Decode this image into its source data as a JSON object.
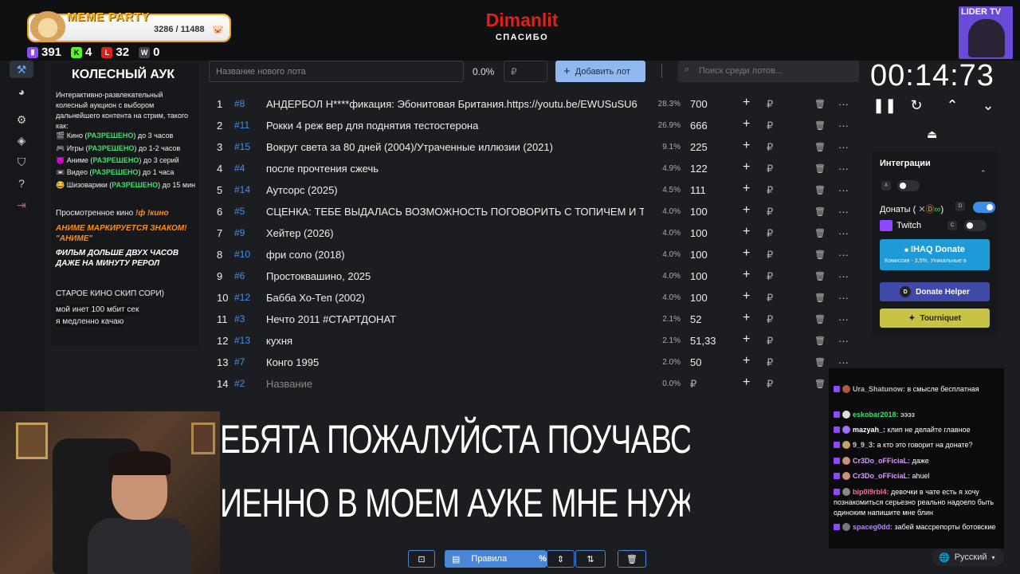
{
  "overlay": {
    "meme_party_title": "MEME PARTY",
    "meme_party_count": "3286 / 11488",
    "stats": [
      {
        "icon": "twitch-icon",
        "value": "391",
        "color": "#9146ff"
      },
      {
        "icon": "kick-icon",
        "value": "4",
        "color": "#53fc18"
      },
      {
        "icon": "vk-live-icon",
        "value": "32",
        "color": "#e0201b"
      },
      {
        "icon": "w-icon",
        "value": "0",
        "color": "#444444"
      }
    ],
    "streamer_title": "Dimanlit",
    "streamer_sub": "СПАСИБО",
    "lider_label": "LIDER TV"
  },
  "rules_panel": {
    "title": "КОЛЕСНЫЙ АУК",
    "intro": "Интерактивно-развлекательный колесный аукцион с выбором дальнейшего контента на стрим, такого как:",
    "items": [
      {
        "icon": "🎬",
        "before": "Кино (",
        "status": "РАЗРЕШЕНО",
        "after": ") до 3 часов"
      },
      {
        "icon": "🎮",
        "before": "Игры (",
        "status": "РАЗРЕШЕНО",
        "after": ") до 1-2 часов"
      },
      {
        "icon": "😈",
        "before": "Аниме (",
        "status": "РАЗРЕШЕНО",
        "after": ") до 3 серий"
      },
      {
        "icon": "📼",
        "before": "Видео (",
        "status": "РАЗРЕШЕНО",
        "after": ") до 1 часа"
      },
      {
        "icon": "😂",
        "before": "Шизоварики (",
        "status": "РАЗРЕШЕНО",
        "after": ") до 15 мин"
      }
    ],
    "watched_label": "Просмотренное кино",
    "watched_cmd": "!ф !кино",
    "anime_note": "АНИМЕ МАРКИРУЕТСЯ ЗНАКОМ! \"АНИМЕ\"",
    "long_note": "ФИЛЬМ ДОЛЬШЕ ДВУХ ЧАСОВ ДАЖЕ НА МИНУТУ РЕРОЛ",
    "old_note": "СТАРОЕ КИНО СКИП СОРИ)",
    "net_line1": "мой инет 100 мбит сек",
    "net_line2": "я медленно качаю"
  },
  "toolbar": {
    "lot_placeholder": "Название нового лота",
    "percent_total": "0.0%",
    "price_placeholder": "₽",
    "add_button": "Добавить лот",
    "search_placeholder": "Поиск среди лотов..."
  },
  "lots": [
    {
      "num": "1",
      "id": "#8",
      "name": "АНДЕРБОЛ Н****фикация: Эбонитовая Британия.https://youtu.be/EWUSuSU6",
      "pct": "28.3%",
      "amount": "700"
    },
    {
      "num": "2",
      "id": "#11",
      "name": "Рокки 4 реж вер для поднятия тестостерона",
      "pct": "26.9%",
      "amount": "666"
    },
    {
      "num": "3",
      "id": "#15",
      "name": "Вокруг света за 80 дней (2004)/Утраченные иллюзии (2021)",
      "pct": "9.1%",
      "amount": "225"
    },
    {
      "num": "4",
      "id": "#4",
      "name": "после прочтения сжечь",
      "pct": "4.9%",
      "amount": "122"
    },
    {
      "num": "5",
      "id": "#14",
      "name": "Аутсорс (2025)",
      "pct": "4.5%",
      "amount": "111"
    },
    {
      "num": "6",
      "id": "#5",
      "name": "СЦЕНКА: ТЕБЕ ВЫДАЛАСЬ ВОЗМОЖНОСТЬ ПОГОВОРИТЬ С ТОПИЧЕМ И ТЫ",
      "pct": "4.0%",
      "amount": "100"
    },
    {
      "num": "7",
      "id": "#9",
      "name": "Хейтер (2026)",
      "pct": "4.0%",
      "amount": "100"
    },
    {
      "num": "8",
      "id": "#10",
      "name": "фри соло (2018)",
      "pct": "4.0%",
      "amount": "100"
    },
    {
      "num": "9",
      "id": "#6",
      "name": "Простоквашино, 2025",
      "pct": "4.0%",
      "amount": "100"
    },
    {
      "num": "10",
      "id": "#12",
      "name": "Бабба Хо-Теп (2002)",
      "pct": "4.0%",
      "amount": "100"
    },
    {
      "num": "11",
      "id": "#3",
      "name": "Нечто 2011 #СТАРТДОНАТ",
      "pct": "2.1%",
      "amount": "52"
    },
    {
      "num": "12",
      "id": "#13",
      "name": "кухня",
      "pct": "2.1%",
      "amount": "51,33"
    },
    {
      "num": "13",
      "id": "#7",
      "name": "Конго 1995",
      "pct": "2.0%",
      "amount": "50"
    },
    {
      "num": "14",
      "id": "#2",
      "name": "Название",
      "pct": "0.0%",
      "amount": "₽"
    }
  ],
  "lot_icons": {
    "plus": "+",
    "rub": "₽",
    "more": "···"
  },
  "timer": {
    "value": "00:14:73"
  },
  "integrations": {
    "title": "Интеграции",
    "key_a": "A",
    "donate_label": "Донаты (",
    "key_d": "D",
    "twitch_label": "Twitch",
    "key_c": "C",
    "ihaq_title": "IHAQ Donate",
    "ihaq_sub": "Комиссия - 3,5%. Уникальные в",
    "donate_helper": "Donate Helper",
    "tourniquet": "Tourniquet"
  },
  "chat": [
    {
      "nick": "Ura_Shatunow:",
      "color": "#bbbbbb",
      "text": " в смысле бесплатная"
    },
    {
      "nick": "eskobar2018:",
      "color": "#3ee06a",
      "text": " эээз"
    },
    {
      "nick": "mazyah_:",
      "color": "#ffffff",
      "text": " клип не делайте главное"
    },
    {
      "nick": "9_9_3:",
      "color": "#cccccc",
      "text": " а кто это говорит на донате?"
    },
    {
      "nick": "Cr3Do_oFFiciaL:",
      "color": "#d89cff",
      "text": " даже"
    },
    {
      "nick": "Cr3Do_oFFiciaL:",
      "color": "#d89cff",
      "text": " ahuel"
    },
    {
      "nick": "bip0l9rbl4:",
      "color": "#ff6b9a",
      "text": " девочки в чате есть я хочу познакомиться серьезно реально надоело быть одиноким напишите мне блин"
    },
    {
      "nick": "spaceg0dd:",
      "color": "#b586ff",
      "text": " забей массрепорты ботовские"
    }
  ],
  "language": "Русский",
  "captions": {
    "line1": "ЕБЯТА ПОЖАЛУЙСТА ПОУЧАВСТВУЙТЕ РЕ",
    "line2": "ИЕННО В МОЕМ АУКЕ МНЕ НУЖНЕЕ       ИМ"
  },
  "bottom_bar": {
    "rules_label": "Правила",
    "percent": "%"
  }
}
